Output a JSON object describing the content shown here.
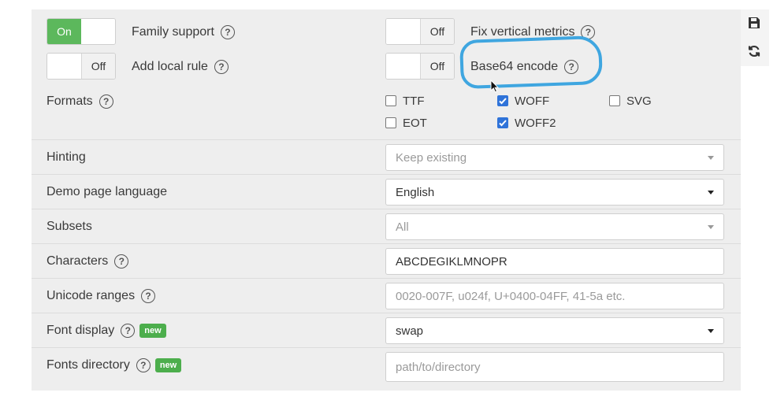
{
  "toggles": {
    "family_support": {
      "label": "Family support",
      "state": "On"
    },
    "add_local_rule": {
      "label": "Add local rule",
      "state": "Off"
    },
    "fix_vertical_metrics": {
      "label": "Fix vertical metrics",
      "state": "Off"
    },
    "base64_encode": {
      "label": "Base64 encode",
      "state": "Off"
    }
  },
  "help_glyph": "?",
  "formats": {
    "label": "Formats",
    "options": [
      {
        "label": "TTF",
        "checked": false
      },
      {
        "label": "WOFF",
        "checked": true
      },
      {
        "label": "SVG",
        "checked": false
      },
      {
        "label": "EOT",
        "checked": false
      },
      {
        "label": "WOFF2",
        "checked": true
      }
    ]
  },
  "rows": {
    "hinting": {
      "label": "Hinting",
      "value": "Keep existing"
    },
    "demo_language": {
      "label": "Demo page language",
      "value": "English"
    },
    "subsets": {
      "label": "Subsets",
      "value": "All"
    },
    "characters": {
      "label": "Characters",
      "value": "ABCDEGIKLMNOPR"
    },
    "unicode_ranges": {
      "label": "Unicode ranges",
      "placeholder": "0020-007F, u024f, U+0400-04FF, 41-5a etc."
    },
    "font_display": {
      "label": "Font display",
      "value": "swap",
      "badge": "new"
    },
    "fonts_directory": {
      "label": "Fonts directory",
      "placeholder": "path/to/directory",
      "badge": "new"
    }
  },
  "side_tools": [
    "save-icon",
    "refresh-icon"
  ],
  "colors": {
    "toggle_on": "#5cb85c",
    "badge": "#4cae4c",
    "checkbox": "#2f73d9",
    "highlight": "#3fa6e0"
  }
}
